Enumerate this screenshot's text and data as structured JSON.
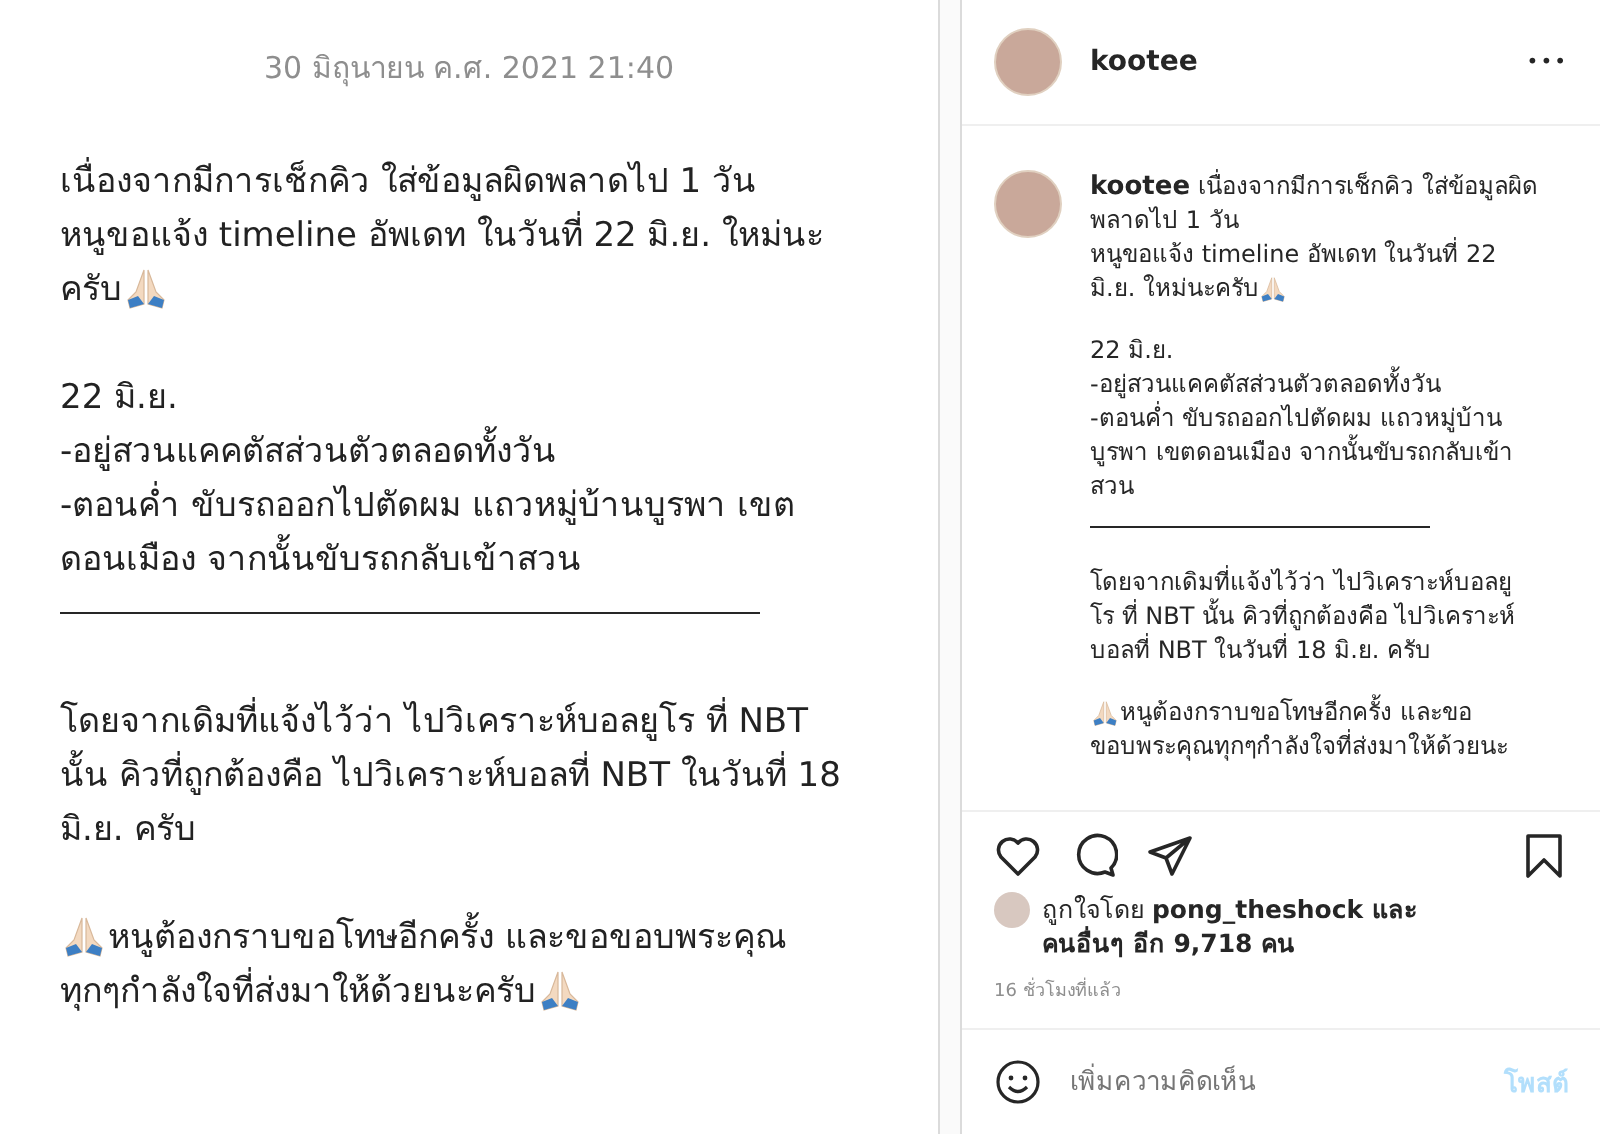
{
  "post_image": {
    "date": "30 มิถุนายน ค.ศ. 2021 21:40",
    "paragraphs": [
      [
        [
          {
            "kind": "text",
            "text": "เนื่องจากมีการเช็กคิว ใส่ข้อมูลผิดพลาดไป 1 วัน"
          }
        ],
        [
          {
            "kind": "text",
            "text": "หนูขอแจ้ง timeline อัพเดท ในวันที่ 22 มิ.ย. ใหม่นะ"
          }
        ],
        [
          {
            "kind": "text",
            "text": "ครับ"
          },
          {
            "kind": "emoji"
          }
        ]
      ],
      [
        [
          {
            "kind": "text",
            "text": "22 มิ.ย."
          }
        ],
        [
          {
            "kind": "text",
            "text": "-อยู่สวนแคคตัสส่วนตัวตลอดทั้งวัน"
          }
        ],
        [
          {
            "kind": "text",
            "text": "-ตอนค่ำ ขับรถออกไปตัดผม แถวหมู่บ้านบูรพา เขต"
          }
        ],
        [
          {
            "kind": "text",
            "text": "ดอนเมือง จากนั้นขับรถกลับเข้าสวน"
          }
        ],
        [
          {
            "kind": "rule"
          }
        ]
      ],
      [
        [
          {
            "kind": "text",
            "text": "โดยจากเดิมที่แจ้งไว้ว่า ไปวิเคราะห์บอลยูโร ที่ NBT"
          }
        ],
        [
          {
            "kind": "text",
            "text": "นั้น คิวที่ถูกต้องคือ ไปวิเคราะห์บอลที่ NBT ในวันที่ 18"
          }
        ],
        [
          {
            "kind": "text",
            "text": "มิ.ย. ครับ"
          }
        ]
      ],
      [
        [
          {
            "kind": "emoji"
          },
          {
            "kind": "text",
            "text": " หนูต้องกราบขอโทษอีกครั้ง และขอขอบพระคุณ"
          }
        ],
        [
          {
            "kind": "text",
            "text": "ทุกๆกำลังใจที่ส่งมาให้ด้วยนะครับ "
          },
          {
            "kind": "emoji"
          }
        ]
      ]
    ]
  },
  "header": {
    "username": "kootee",
    "more": "•••"
  },
  "caption": {
    "username": "kootee",
    "paragraphs": [
      [
        [
          {
            "kind": "text",
            "text": "เนื่องจากมีการเช็กคิว ใส่ข้อมูลผิด"
          }
        ],
        [
          {
            "kind": "text",
            "text": "พลาดไป 1 วัน"
          }
        ],
        [
          {
            "kind": "text",
            "text": "หนูขอแจ้ง timeline อัพเดท ในวันที่ 22"
          }
        ],
        [
          {
            "kind": "text",
            "text": "มิ.ย. ใหม่นะครับ"
          },
          {
            "kind": "emoji"
          }
        ]
      ],
      [
        [
          {
            "kind": "text",
            "text": "22 มิ.ย."
          }
        ],
        [
          {
            "kind": "text",
            "text": "-อยู่สวนแคคตัสส่วนตัวตลอดทั้งวัน"
          }
        ],
        [
          {
            "kind": "text",
            "text": "-ตอนค่ำ ขับรถออกไปตัดผม แถวหมู่บ้าน"
          }
        ],
        [
          {
            "kind": "text",
            "text": "บูรพา เขตดอนเมือง จากนั้นขับรถกลับเข้า"
          }
        ],
        [
          {
            "kind": "text",
            "text": "สวน"
          }
        ],
        [
          {
            "kind": "rule"
          }
        ]
      ],
      [
        [
          {
            "kind": "text",
            "text": "โดยจากเดิมที่แจ้งไว้ว่า ไปวิเคราะห์บอลยู"
          }
        ],
        [
          {
            "kind": "text",
            "text": "โร ที่ NBT นั้น คิวที่ถูกต้องคือ ไปวิเคราะห์"
          }
        ],
        [
          {
            "kind": "text",
            "text": "บอลที่ NBT ในวันที่ 18 มิ.ย. ครับ"
          }
        ]
      ],
      [
        [
          {
            "kind": "emoji"
          },
          {
            "kind": "text",
            "text": " หนูต้องกราบขอโทษอีกครั้ง และขอ"
          }
        ],
        [
          {
            "kind": "text",
            "text": "ขอบพระคุณทุกๆกำลังใจที่ส่งมาให้ด้วยนะ"
          }
        ]
      ]
    ]
  },
  "likes": {
    "text": "ถูกใจโดย **pong_theshock และ\nคนอื่นๆ อีก 9,718 คน**"
  },
  "time": "16 ชั่วโมงที่แล้ว",
  "comment": {
    "placeholder": "เพิ่มความคิดเห็น",
    "post": "โพสต์"
  }
}
